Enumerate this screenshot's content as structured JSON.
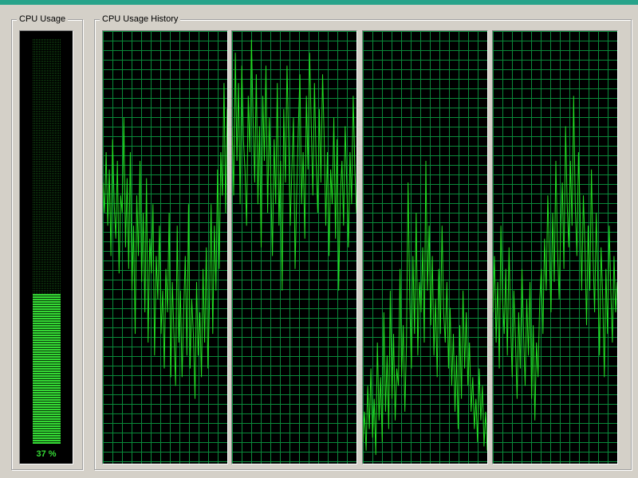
{
  "cpu_usage": {
    "title": "CPU Usage",
    "percent": 37,
    "label": "37 %"
  },
  "cpu_history": {
    "title": "CPU Usage History",
    "colors": {
      "grid": "#0a8a3a",
      "line": "#22e022",
      "background": "#000000"
    },
    "chart_data": {
      "type": "line",
      "ylim": [
        0,
        100
      ],
      "grid": true,
      "series": [
        {
          "values": [
            65,
            58,
            72,
            55,
            68,
            48,
            75,
            60,
            52,
            70,
            44,
            62,
            58,
            80,
            50,
            66,
            45,
            72,
            40,
            55,
            30,
            62,
            48,
            70,
            42,
            58,
            35,
            66,
            28,
            52,
            44,
            60,
            25,
            48,
            38,
            55,
            30,
            40,
            22,
            45,
            35,
            58,
            20,
            42,
            30,
            18,
            55,
            28,
            40,
            20,
            35,
            48,
            25,
            60,
            22,
            38,
            30,
            15,
            42,
            25,
            35,
            20,
            45,
            28,
            50,
            22,
            38,
            60,
            30,
            55,
            40,
            68,
            45,
            72,
            62,
            88,
            58,
            82
          ]
        },
        {
          "values": [
            78,
            62,
            95,
            70,
            88,
            60,
            92,
            75,
            68,
            55,
            85,
            72,
            98,
            80,
            65,
            90,
            60,
            78,
            50,
            85,
            70,
            92,
            58,
            80,
            65,
            48,
            75,
            60,
            88,
            55,
            70,
            40,
            82,
            65,
            92,
            75,
            55,
            68,
            80,
            45,
            62,
            78,
            90,
            60,
            72,
            52,
            85,
            68,
            95,
            78,
            62,
            88,
            70,
            58,
            82,
            65,
            90,
            75,
            55,
            72,
            48,
            68,
            60,
            80,
            52,
            75,
            40,
            62,
            70,
            55,
            78,
            65,
            50,
            72,
            60,
            85,
            68,
            58
          ]
        },
        {
          "values": [
            5,
            12,
            3,
            18,
            8,
            22,
            6,
            15,
            2,
            28,
            10,
            20,
            5,
            35,
            12,
            25,
            8,
            40,
            15,
            30,
            10,
            22,
            18,
            45,
            20,
            32,
            12,
            28,
            65,
            38,
            22,
            48,
            30,
            58,
            25,
            42,
            35,
            50,
            28,
            70,
            40,
            55,
            32,
            48,
            25,
            38,
            20,
            45,
            30,
            55,
            35,
            28,
            42,
            22,
            36,
            18,
            30,
            12,
            25,
            8,
            32,
            15,
            40,
            22,
            35,
            18,
            28,
            12,
            20,
            8,
            15,
            5,
            22,
            10,
            18,
            4,
            12,
            3
          ]
        },
        {
          "values": [
            35,
            48,
            28,
            42,
            22,
            55,
            38,
            30,
            45,
            25,
            50,
            32,
            20,
            40,
            28,
            15,
            35,
            22,
            45,
            30,
            18,
            38,
            25,
            42,
            15,
            32,
            10,
            28,
            20,
            38,
            45,
            30,
            52,
            40,
            62,
            48,
            35,
            58,
            42,
            70,
            50,
            38,
            55,
            65,
            45,
            78,
            60,
            50,
            70,
            55,
            85,
            60,
            48,
            72,
            58,
            40,
            62,
            50,
            32,
            55,
            40,
            68,
            48,
            35,
            58,
            42,
            25,
            50,
            38,
            20,
            45,
            30,
            55,
            40,
            28,
            48,
            35,
            42
          ]
        }
      ]
    }
  }
}
